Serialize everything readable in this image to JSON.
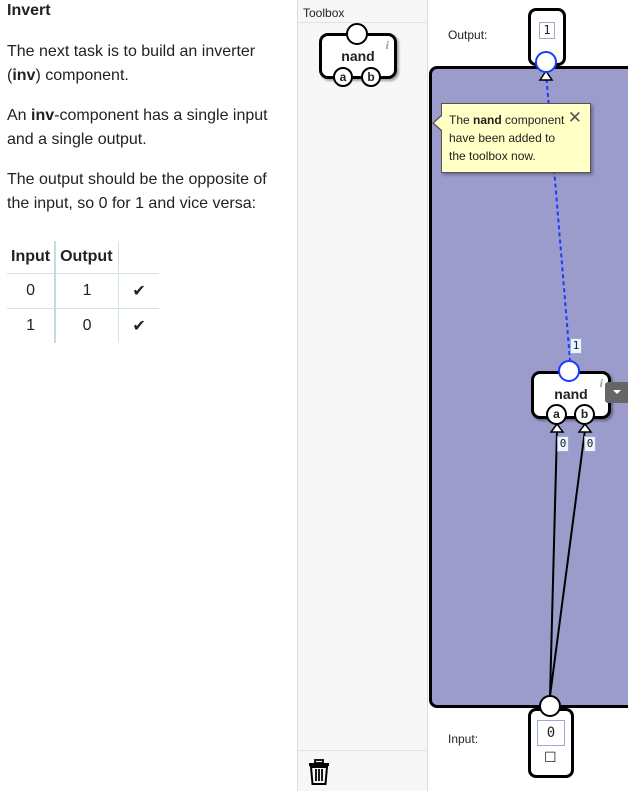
{
  "level": {
    "title": "Invert",
    "para1_pre": "The next task is to build an inverter (",
    "para1_bold": "inv",
    "para1_post": ") component.",
    "para2_pre": "An ",
    "para2_bold": "inv",
    "para2_post": "-component has a single input and a single output.",
    "para3": "The output should be the opposite of the input, so 0 for 1 and vice versa:"
  },
  "truth_table": {
    "headers": [
      "Input",
      "Output",
      ""
    ],
    "rows": [
      {
        "input": "0",
        "output": "1",
        "status": "✔"
      },
      {
        "input": "1",
        "output": "0",
        "status": "✔"
      }
    ]
  },
  "toolbox": {
    "title": "Toolbox",
    "items": [
      {
        "name": "nand",
        "info": "i",
        "inputs": [
          "a",
          "b"
        ]
      }
    ],
    "trash_icon": "trash-icon"
  },
  "canvas": {
    "output_label": "Output:",
    "output_value": "1",
    "input_label": "Input:",
    "input_value": "0",
    "input_toggle": "☐",
    "gate": {
      "name": "nand",
      "info": "i",
      "inputs": [
        "a",
        "b"
      ],
      "output_value": "1",
      "input_values": [
        "0",
        "0"
      ]
    },
    "tooltip": {
      "pre": "The ",
      "bold": "nand",
      "post": " component have been added to the toolbox now.",
      "close": "✕"
    }
  },
  "colors": {
    "board": "#9b9ccb",
    "tooltip_bg": "#ffffc6",
    "active_wire": "#1a3cff"
  }
}
